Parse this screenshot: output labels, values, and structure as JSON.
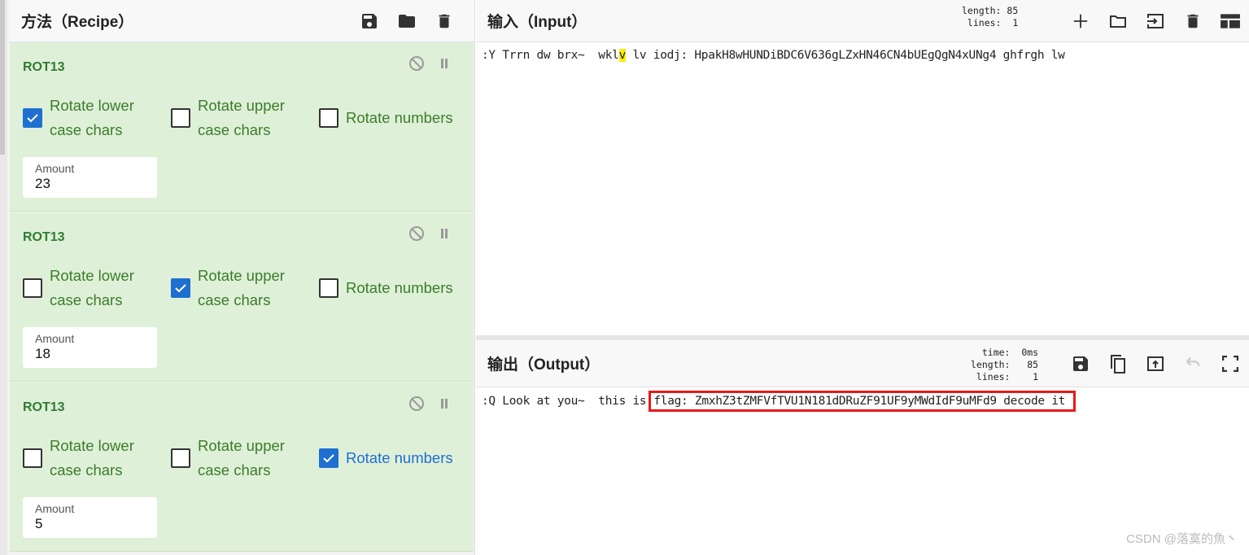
{
  "recipe": {
    "title": "方法（Recipe）",
    "icons": [
      "save-icon",
      "folder-icon",
      "trash-icon"
    ],
    "operations": [
      {
        "name": "ROT13",
        "options": [
          {
            "label_1": "Rotate lower",
            "label_2": "case chars",
            "checked": true
          },
          {
            "label_1": "Rotate upper",
            "label_2": "case chars",
            "checked": false
          },
          {
            "label_1": "Rotate numbers",
            "checked": false
          }
        ],
        "amount_label": "Amount",
        "amount": "23"
      },
      {
        "name": "ROT13",
        "options": [
          {
            "label_1": "Rotate lower",
            "label_2": "case chars",
            "checked": false
          },
          {
            "label_1": "Rotate upper",
            "label_2": "case chars",
            "checked": true
          },
          {
            "label_1": "Rotate numbers",
            "checked": false
          }
        ],
        "amount_label": "Amount",
        "amount": "18"
      },
      {
        "name": "ROT13",
        "options": [
          {
            "label_1": "Rotate lower",
            "label_2": "case chars",
            "checked": false
          },
          {
            "label_1": "Rotate upper",
            "label_2": "case chars",
            "checked": false
          },
          {
            "label_1": "Rotate numbers",
            "checked": true
          }
        ],
        "amount_label": "Amount",
        "amount": "5"
      }
    ]
  },
  "input": {
    "title": "输入（Input）",
    "length_label": "length:",
    "length": "85",
    "lines_label": "lines:",
    "lines": "1",
    "text_before": ":Y Trrn dw brx~  wkl",
    "text_highlight": "v",
    "text_after": " lv iodj: HpakH8wHUNDiBDC6V636gLZxHN46CN4bUEgQgN4xUNg4 ghfrgh lw"
  },
  "output": {
    "title": "输出（Output）",
    "time_label": "time:",
    "time": "0ms",
    "length_label": "length:",
    "length": "85",
    "lines_label": "lines:",
    "lines": "1",
    "text_before": ":Q Look at you~  this is",
    "text_flag": "flag: ZmxhZ3tZMFVfTVU1N181dDRuZF91UF9yMWdIdF9uMFd9 decode it"
  },
  "watermark": "CSDN @落寞的魚丶",
  "colors": {
    "op_bg": "#dff0d8",
    "op_title": "#2e7d32",
    "checkbox_on": "#1e6fd0",
    "highlight": "#ffeb00",
    "flag_box": "#e8191b"
  }
}
